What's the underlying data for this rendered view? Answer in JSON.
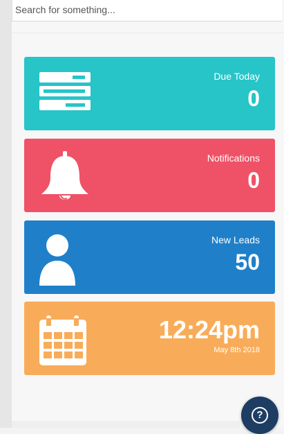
{
  "search": {
    "placeholder": "Search for something..."
  },
  "cards": {
    "due_today": {
      "label": "Due Today",
      "count": "0",
      "icon": "list-icon",
      "color": "#27c4c8"
    },
    "notifications": {
      "label": "Notifications",
      "count": "0",
      "icon": "bell-icon",
      "color": "#ef5266"
    },
    "new_leads": {
      "label": "New Leads",
      "count": "50",
      "icon": "user-icon",
      "color": "#1f80c9"
    },
    "clock": {
      "time": "12:24pm",
      "date": "May 8th 2018",
      "icon": "calendar-icon",
      "color": "#f8ac59"
    }
  },
  "help": {
    "icon": "help-icon",
    "symbol": "?",
    "color": "#1d3d63"
  }
}
